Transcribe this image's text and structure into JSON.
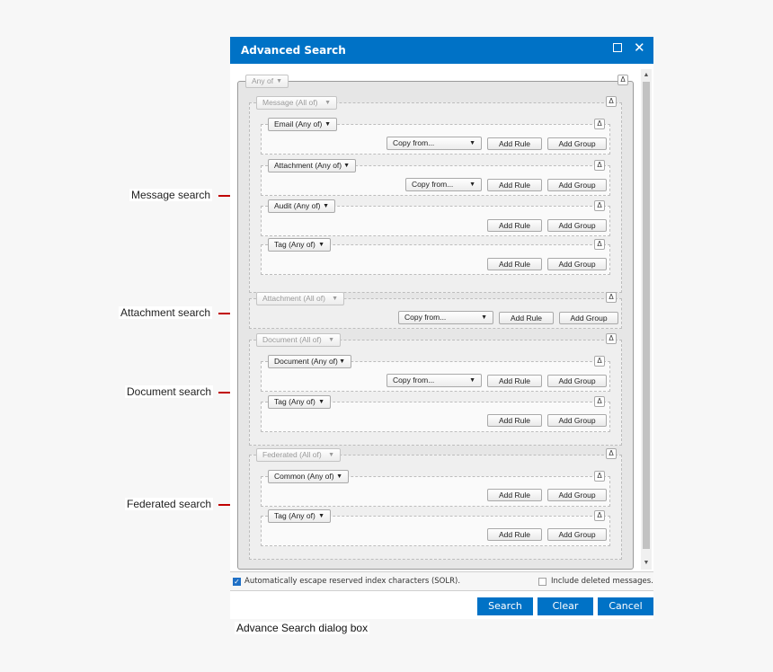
{
  "dialog": {
    "title": "Advanced Search",
    "maximize_icon": "maximize-icon",
    "close_icon": "close-icon",
    "close_glyph": "✕"
  },
  "common": {
    "collapse_glyph": "Δ",
    "arrow_glyph": "▼",
    "add_rule": "Add Rule",
    "add_group": "Add Group",
    "copy_from": "Copy from..."
  },
  "root": {
    "label": "Any of"
  },
  "groups": {
    "message": {
      "label": "Message (All of)",
      "subgroups": {
        "email": "Email (Any of)",
        "attachment": "Attachment (Any of)",
        "audit": "Audit (Any of)",
        "tag": "Tag (Any of)"
      }
    },
    "attachment": {
      "label": "Attachment (All of)"
    },
    "document": {
      "label": "Document (All of)",
      "subgroups": {
        "document": "Document (Any of)",
        "tag": "Tag (Any of)"
      }
    },
    "federated": {
      "label": "Federated (All of)",
      "subgroups": {
        "common": "Common (Any of)",
        "tag": "Tag (Any of)"
      }
    }
  },
  "options": {
    "escape_solr": {
      "label": "Automatically escape reserved index characters (SOLR).",
      "checked": true
    },
    "include_deleted": {
      "label": "Include deleted messages.",
      "checked": false
    }
  },
  "actions": {
    "search": "Search",
    "clear": "Clear",
    "cancel": "Cancel"
  },
  "annotations": {
    "message": "Message search",
    "attachment": "Attachment search",
    "document": "Document search",
    "federated": "Federated search"
  },
  "caption": "Advance Search dialog box",
  "colors": {
    "accent": "#0072c6",
    "annotation": "#c00000"
  }
}
